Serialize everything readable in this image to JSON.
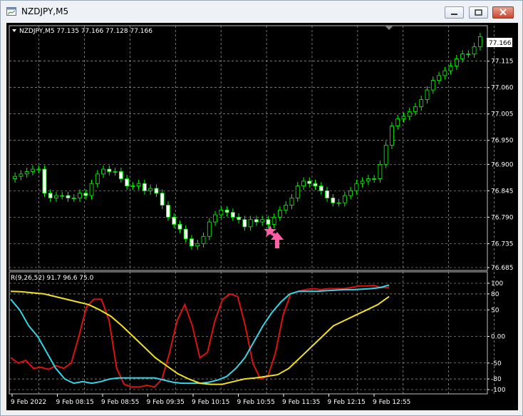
{
  "window": {
    "title": "NZDJPY,M5"
  },
  "main_panel": {
    "header": "NZDJPY,M5  77.135 77.166 77.128 77.166",
    "price_label": "77.166",
    "price_ticks": [
      "77.115",
      "77.060",
      "77.005",
      "76.950",
      "76.900",
      "76.845",
      "76.790",
      "76.735",
      "76.685"
    ]
  },
  "indicator_panel": {
    "header": "R(9,26,52) 91.7 96.6 75.0",
    "ticks": [
      "100",
      "80",
      "50",
      "0.00",
      "-50",
      "-80",
      "-100"
    ]
  },
  "time_axis": {
    "labels": [
      "9 Feb 2022",
      "9 Feb 08:15",
      "9 Feb 08:55",
      "9 Feb 09:35",
      "9 Feb 10:15",
      "9 Feb 10:55",
      "9 Feb 11:35",
      "9 Feb 12:15",
      "9 Feb 12:55"
    ]
  },
  "signal": {
    "star_icon": "pink-star",
    "arrow_icon": "pink-up-arrow"
  },
  "colors": {
    "background": "#000000",
    "grid": "#c0c0c0",
    "candle": "#00ff00",
    "bull_body": "#000000",
    "bear_body": "#ffffff",
    "line_red": "#dd1111",
    "line_cyan": "#33d6e6",
    "line_yellow": "#f0e020",
    "signal": "#ff5fa8"
  },
  "chart_data": [
    {
      "type": "candlestick",
      "title": "NZDJPY,M5",
      "ylim": [
        76.685,
        77.18
      ],
      "close": [
        76.875,
        76.88,
        76.885,
        76.89,
        76.89,
        76.84,
        76.83,
        76.835,
        76.835,
        76.83,
        76.83,
        76.84,
        76.835,
        76.86,
        76.88,
        76.89,
        76.885,
        76.885,
        76.87,
        76.855,
        76.855,
        76.86,
        76.845,
        76.85,
        76.84,
        76.815,
        76.79,
        76.775,
        76.765,
        76.745,
        76.73,
        76.735,
        76.75,
        76.78,
        76.795,
        76.805,
        76.8,
        76.79,
        76.785,
        76.77,
        76.785,
        76.78,
        76.785,
        76.775,
        76.79,
        76.805,
        76.815,
        76.83,
        76.855,
        76.865,
        76.86,
        76.855,
        76.845,
        76.83,
        76.82,
        76.82,
        76.835,
        76.845,
        76.86,
        76.865,
        76.87,
        76.87,
        76.9,
        76.94,
        76.98,
        76.995,
        77.0,
        77.01,
        77.02,
        77.035,
        77.055,
        77.075,
        77.085,
        77.095,
        77.105,
        77.12,
        77.13,
        77.13,
        77.145,
        77.166
      ]
    },
    {
      "type": "line",
      "title": "R(9,26,52)",
      "ylim": [
        -100,
        100
      ],
      "series": [
        {
          "name": "",
          "color": "#dd1111",
          "values": [
            -40,
            -50,
            -45,
            -60,
            -58,
            -62,
            -55,
            -60,
            -50,
            0,
            55,
            70,
            70,
            30,
            -60,
            -90,
            -95,
            -95,
            -92,
            -95,
            -80,
            -30,
            30,
            60,
            20,
            -40,
            -30,
            30,
            70,
            80,
            75,
            20,
            -50,
            -80,
            -75,
            -30,
            40,
            80,
            85,
            88,
            90,
            88,
            90,
            90,
            90,
            92,
            95,
            95,
            96,
            92,
            91.7
          ]
        },
        {
          "name": "",
          "color": "#33d6e6",
          "values": [
            70,
            50,
            20,
            0,
            -30,
            -60,
            -80,
            -88,
            -85,
            -88,
            -85,
            -80,
            -78,
            -78,
            -78,
            -78,
            -78,
            -82,
            -86,
            -88,
            -88,
            -88,
            -86,
            -82,
            -75,
            -60,
            -40,
            -10,
            20,
            45,
            65,
            80,
            85,
            85,
            85,
            86,
            87,
            88,
            88,
            89,
            90,
            92,
            96.6
          ]
        },
        {
          "name": "",
          "color": "#f0e020",
          "values": [
            85,
            84,
            82,
            80,
            75,
            70,
            65,
            60,
            50,
            38,
            20,
            0,
            -20,
            -40,
            -55,
            -70,
            -80,
            -88,
            -90,
            -90,
            -85,
            -80,
            -78,
            -75,
            -72,
            -60,
            -40,
            -20,
            0,
            20,
            30,
            40,
            50,
            60,
            75
          ]
        }
      ]
    }
  ]
}
